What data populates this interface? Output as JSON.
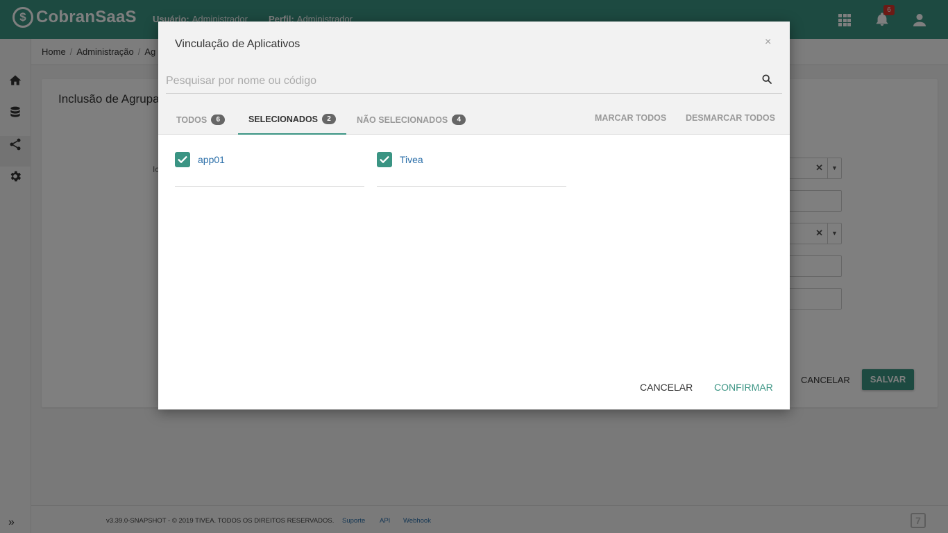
{
  "app": {
    "name": "CobranSaaS",
    "logo_glyph": "$",
    "user_label": "Usuário:",
    "user_value": "Administrador",
    "profile_label": "Perfil:",
    "profile_value": "Administrador",
    "notification_count": "6"
  },
  "breadcrumb": [
    "Home",
    "Administração",
    "Ag"
  ],
  "page": {
    "title": "Inclusão de Agrupa",
    "field_label": "Ic",
    "cancel_label": "CANCELAR",
    "save_label": "SALVAR"
  },
  "footer": {
    "copyright": "v3.39.0-SNAPSHOT - © 2019 TIVEA. TODOS OS DIREITOS RESERVADOS.",
    "links": [
      "Suporte",
      "API",
      "Webhook"
    ],
    "logo_glyph": "7"
  },
  "modal": {
    "title": "Vinculação de Aplicativos",
    "close_glyph": "×",
    "search_placeholder": "Pesquisar por nome ou código",
    "tabs": [
      {
        "label": "TODOS",
        "count": "6"
      },
      {
        "label": "SELECIONADOS",
        "count": "2"
      },
      {
        "label": "NÃO SELECIONADOS",
        "count": "4"
      }
    ],
    "active_tab": "SELECIONADOS",
    "mark_all": "MARCAR TODOS",
    "unmark_all": "DESMARCAR TODOS",
    "items": [
      {
        "label": "app01",
        "checked": true
      },
      {
        "label": "Tivea",
        "checked": true
      }
    ],
    "cancel_label": "CANCELAR",
    "confirm_label": "CONFIRMAR"
  },
  "colors": {
    "primary": "#3a9483",
    "link": "#2a6ea8",
    "badge": "#d9342b"
  }
}
